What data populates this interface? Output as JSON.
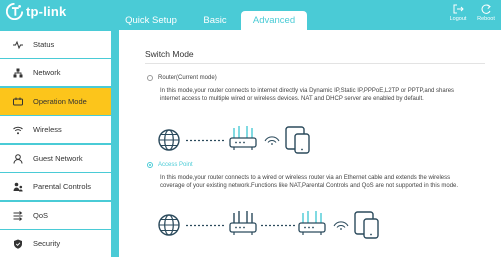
{
  "brand": {
    "name": "tp-link"
  },
  "tabs": [
    {
      "label": "Quick Setup"
    },
    {
      "label": "Basic"
    },
    {
      "label": "Advanced"
    }
  ],
  "header_actions": {
    "logout": "Logout",
    "reboot": "Reboot"
  },
  "sidebar": {
    "items": [
      {
        "label": "Status",
        "icon": "pulse-icon"
      },
      {
        "label": "Network",
        "icon": "network-icon"
      },
      {
        "label": "Operation Mode",
        "icon": "operation-mode-icon",
        "active": true
      },
      {
        "label": "Wireless",
        "icon": "wifi-icon"
      },
      {
        "label": "Guest Network",
        "icon": "guest-icon"
      },
      {
        "label": "Parental Controls",
        "icon": "parental-icon"
      },
      {
        "label": "QoS",
        "icon": "qos-icon"
      },
      {
        "label": "Security",
        "icon": "shield-icon"
      }
    ]
  },
  "main": {
    "title": "Switch Mode",
    "options": [
      {
        "label": "Router(Current mode)",
        "selected": false,
        "description": "In this mode,your router connects to internet directly via Dynamic IP,Static IP,PPPoE,L2TP or PPTP,and shares internet access to multiple wired or wireless devices. NAT and DHCP server are enabled by default."
      },
      {
        "label": "Access Point",
        "selected": true,
        "description": "In this mode,your router connects to a wired or wireless router via an Ethernet cable and extends the wireless coverage of your existing network.Functions like NAT,Parental Controls and QoS are not supported in this mode."
      }
    ]
  },
  "colors": {
    "accent": "#4acbd6",
    "active_item": "#fcc51b",
    "text": "#333333"
  }
}
